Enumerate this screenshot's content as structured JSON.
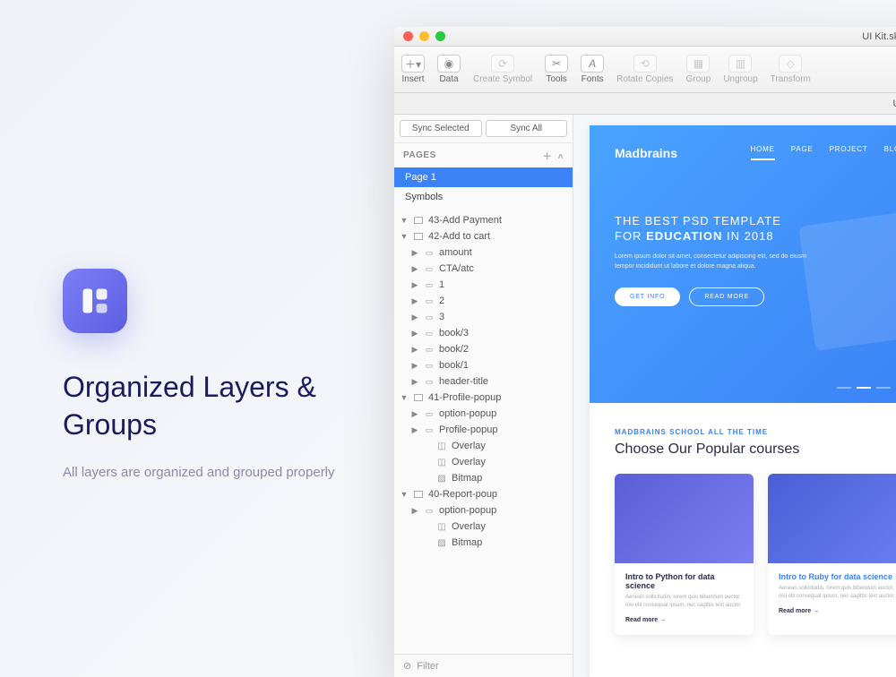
{
  "promo": {
    "title": "Organized Layers & Groups",
    "subtitle": "All layers are organized and grouped properly"
  },
  "window": {
    "title": "UI Kit.sketch",
    "tab": "UI Kit.s"
  },
  "toolbar": {
    "insert": "Insert",
    "data": "Data",
    "create_symbol": "Create Symbol",
    "tools": "Tools",
    "fonts": "Fonts",
    "rotate_copies": "Rotate Copies",
    "group": "Group",
    "ungroup": "Ungroup",
    "transform": "Transform"
  },
  "sidebar": {
    "sync_selected": "Sync Selected",
    "sync_all": "Sync All",
    "pages_label": "PAGES",
    "pages": [
      "Page 1",
      "Symbols"
    ],
    "filter": "Filter",
    "layers": [
      {
        "name": "43-Add Payment",
        "type": "artboard",
        "open": true,
        "indent": 0
      },
      {
        "name": "42-Add to cart",
        "type": "artboard",
        "open": true,
        "indent": 0
      },
      {
        "name": "amount",
        "type": "folder",
        "open": false,
        "indent": 1
      },
      {
        "name": "CTA/atc",
        "type": "folder",
        "open": false,
        "indent": 1
      },
      {
        "name": "1",
        "type": "folder",
        "open": false,
        "indent": 1
      },
      {
        "name": "2",
        "type": "folder",
        "open": false,
        "indent": 1
      },
      {
        "name": "3",
        "type": "folder",
        "open": false,
        "indent": 1
      },
      {
        "name": "book/3",
        "type": "folder",
        "open": false,
        "indent": 1
      },
      {
        "name": "book/2",
        "type": "folder",
        "open": false,
        "indent": 1
      },
      {
        "name": "book/1",
        "type": "folder",
        "open": false,
        "indent": 1
      },
      {
        "name": "header-title",
        "type": "folder",
        "open": false,
        "indent": 1
      },
      {
        "name": "41-Profile-popup",
        "type": "artboard",
        "open": true,
        "indent": 0
      },
      {
        "name": "option-popup",
        "type": "folder",
        "open": false,
        "indent": 1
      },
      {
        "name": "Profile-popup",
        "type": "folder",
        "open": false,
        "indent": 1
      },
      {
        "name": "Overlay",
        "type": "slice",
        "open": false,
        "indent": 2
      },
      {
        "name": "Overlay",
        "type": "slice",
        "open": false,
        "indent": 2
      },
      {
        "name": "Bitmap",
        "type": "bitmap",
        "open": false,
        "indent": 2
      },
      {
        "name": "40-Report-poup",
        "type": "artboard",
        "open": true,
        "indent": 0
      },
      {
        "name": "option-popup",
        "type": "folder",
        "open": false,
        "indent": 1
      },
      {
        "name": "Overlay",
        "type": "slice",
        "open": false,
        "indent": 2
      },
      {
        "name": "Bitmap",
        "type": "bitmap",
        "open": false,
        "indent": 2
      }
    ]
  },
  "canvas": {
    "brand": "Madbrains",
    "nav": [
      "HOME",
      "PAGE",
      "PROJECT",
      "BLOG"
    ],
    "hero_line1": "THE BEST",
    "hero_bold1": "PSD TEMPLATE",
    "hero_line2": "FOR",
    "hero_bold2": "EDUCATION",
    "hero_line3": "IN 2018",
    "hero_sub": "Lorem ipsum dolor sit amet, consectetur adipiscing elit, sed do eiusm tempor incididunt ut labore et dolore magna aliqua.",
    "btn_primary": "GET INFO",
    "btn_secondary": "READ MORE",
    "courses_kicker": "MADBRAINS SCHOOL ALL THE TIME",
    "courses_title": "Choose Our Popular courses",
    "cards": [
      {
        "title": "Intro to Python for data science",
        "desc": "Aenean sollicitudin, lorem quis bibendum auctor, nisi elit consequat ipsum, nec sagittis text auctor.",
        "link": "Read more"
      },
      {
        "title": "Intro to Ruby for data science",
        "desc": "Aenean sollicitudin, lorem quis bibendum auctor, nisi elit consequat ipsum, nec sagittis text auctor.",
        "link": "Read more"
      }
    ]
  }
}
